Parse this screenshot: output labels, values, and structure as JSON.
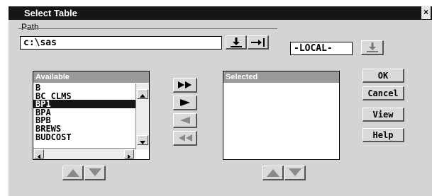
{
  "window": {
    "title": "Select Table",
    "close_glyph": "×"
  },
  "path": {
    "label": "Path",
    "value": "c:\\sas",
    "library_value": "-LOCAL-"
  },
  "available": {
    "header": "Available",
    "items": [
      "B",
      "BC_CLMS",
      "BP1",
      "BPA",
      "BPB",
      "BREWS",
      "BUDCOST"
    ],
    "selected_item": "BP1"
  },
  "selected": {
    "header": "Selected",
    "items": []
  },
  "buttons": {
    "ok": "OK",
    "cancel": "Cancel",
    "view": "View",
    "help": "Help"
  },
  "colors": {
    "titlebar": "#161616",
    "panel": "#d4d4d4",
    "header": "#9a9a9a"
  }
}
